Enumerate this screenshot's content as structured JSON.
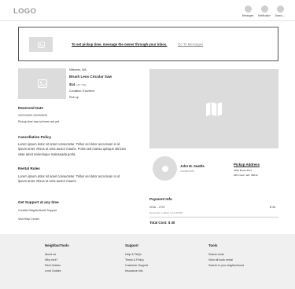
{
  "header": {
    "logo": "LOGO",
    "nav": [
      {
        "label": "Messages",
        "icon": "message-icon"
      },
      {
        "label": "Notification",
        "icon": "notification-icon"
      },
      {
        "label": "Danny",
        "icon": "profile-icon"
      }
    ]
  },
  "banner": {
    "message": "To set pickup time, message the owner through your inbox.",
    "link": "Go To Messages",
    "icon": "image-placeholder-icon"
  },
  "product": {
    "location": "Millcreek, WA",
    "title": "Brush Less Circular Saw",
    "price": "$14",
    "per": "per day",
    "condition": "Condition: Excellent",
    "pickup": "Pick up"
  },
  "reserved": {
    "heading": "Reserved Date",
    "dates": "12/21/2023-12/22/2023",
    "note": "Pickup time has not been set yet."
  },
  "cancellation": {
    "heading": "Cancellation Policy",
    "lines": [
      "Lorem ipsum dolor sit amet consectetur. Tellus vel dolor accumsan in id",
      "ipsum amet. Risus ut urna auctor mauris. Porta sed massa quisque ultricies",
      "vitae amet scelerisque malesuada porta."
    ]
  },
  "rental": {
    "heading": "Rental Rules",
    "lines": [
      "Lorem ipsum dolor sit amet consectetur. Tellus vel dolor accumsan in id",
      "ipsum amet. Risus ut urna auctor mauris."
    ]
  },
  "support": {
    "heading": "Get Support at any time",
    "contact": "Contact Neighbortools Support",
    "help": "Visit Help Center"
  },
  "owner": {
    "name": "John M. Seattle",
    "contact": "Contact info"
  },
  "pickup_address": {
    "heading": "Pickup Address",
    "line1": "4590 Brook Blvd",
    "line2": "Mill Creek, WA, 98012"
  },
  "payment": {
    "heading": "Payment Info",
    "card": "VISA ...2707",
    "amount": "$ 30",
    "date": "December 1 2023, 3:14:28 PM",
    "total": "Total Cost: $ 30"
  },
  "footer": {
    "columns": [
      {
        "heading": "NeighborTools",
        "links": [
          "About us",
          "Why rent?",
          "Rent Guides",
          "Lend Guides"
        ]
      },
      {
        "heading": "Support",
        "links": [
          "Help & FAQs",
          "Terms & Policy",
          "Customer Support",
          "Insurance info"
        ]
      },
      {
        "heading": "Tools",
        "links": [
          "Search tools",
          "View all tools rental",
          "Search in you neighborhood"
        ]
      }
    ]
  }
}
